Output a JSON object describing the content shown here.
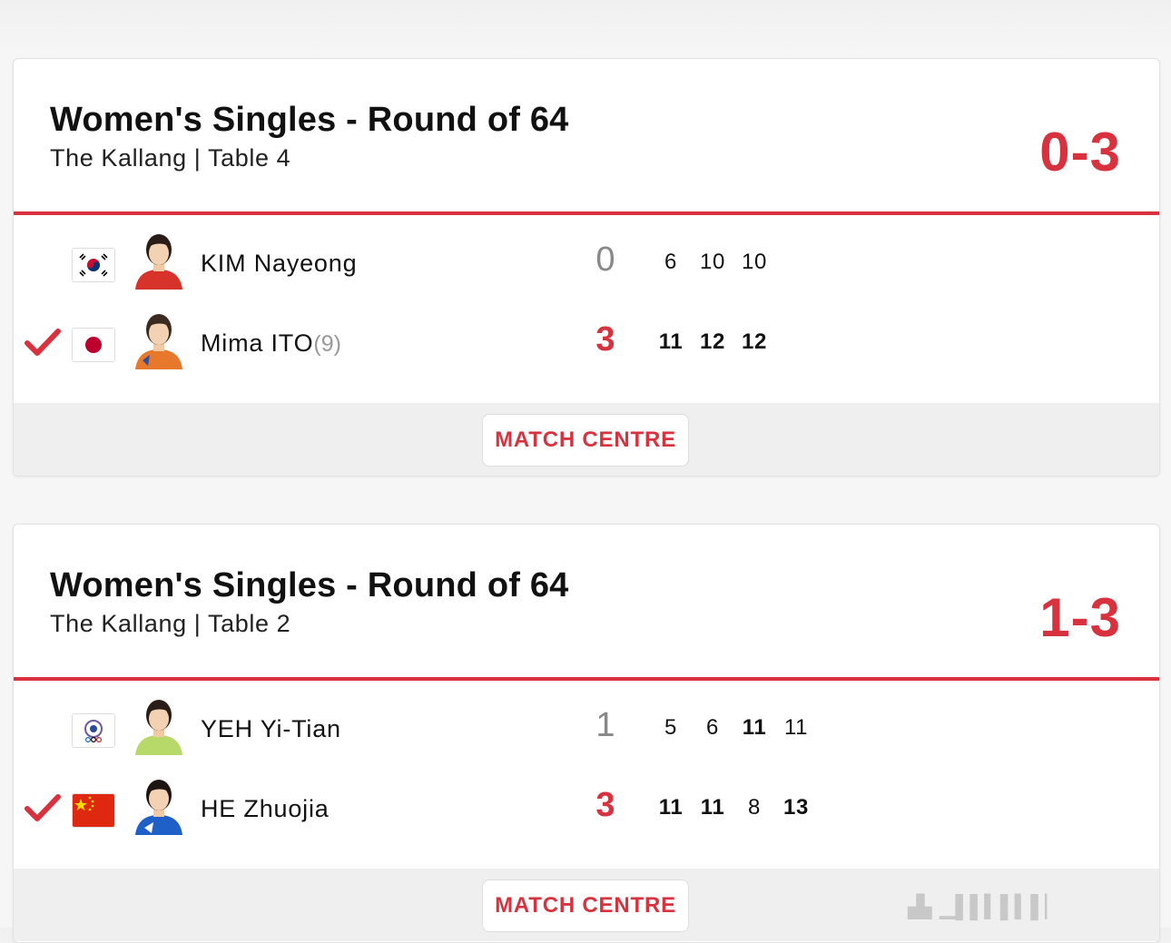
{
  "matches": [
    {
      "title": "Women's Singles - Round of 64",
      "venue": "The Kallang | Table 4",
      "score": "0-3",
      "players": [
        {
          "name": "KIM Nayeong",
          "seed": "",
          "flag": "korea-flag",
          "games": "0",
          "winner": false,
          "sets": [
            "6",
            "10",
            "10"
          ],
          "bold": [
            false,
            false,
            false
          ]
        },
        {
          "name": "Mima ITO",
          "seed": "(9)",
          "flag": "japan-flag",
          "games": "3",
          "winner": true,
          "sets": [
            "11",
            "12",
            "12"
          ],
          "bold": [
            true,
            true,
            true
          ]
        }
      ],
      "button": "MATCH CENTRE"
    },
    {
      "title": "Women's Singles - Round of 64",
      "venue": "The Kallang | Table 2",
      "score": "1-3",
      "players": [
        {
          "name": "YEH Yi-Tian",
          "seed": "",
          "flag": "chinese-taipei-flag",
          "games": "1",
          "winner": false,
          "sets": [
            "5",
            "6",
            "11",
            "11"
          ],
          "bold": [
            false,
            false,
            true,
            false
          ]
        },
        {
          "name": "HE Zhuojia",
          "seed": "",
          "flag": "china-flag",
          "games": "3",
          "winner": true,
          "sets": [
            "11",
            "11",
            "8",
            "13"
          ],
          "bold": [
            true,
            true,
            false,
            true
          ]
        }
      ],
      "button": "MATCH CENTRE"
    }
  ],
  "colors": {
    "accent": "#d9323f"
  }
}
